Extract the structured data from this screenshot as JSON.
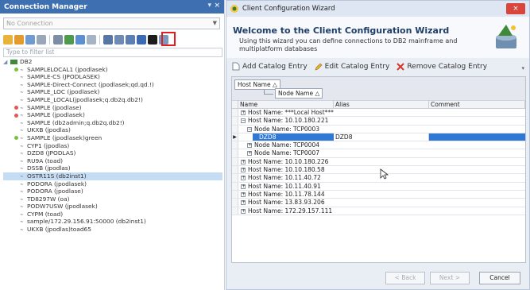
{
  "connection_manager": {
    "title": "Connection Manager",
    "title_controls": [
      "▾",
      "×"
    ],
    "connection_placeholder": "No Connection",
    "filter_placeholder": "Type to filter list",
    "tree": [
      {
        "label": "DB2",
        "status": "none",
        "level": 0
      },
      {
        "label": "SAMPLELOCAL1 (jpodlasek)",
        "status": "green",
        "level": 1
      },
      {
        "label": "SAMPLE-CS (JPODLASEK)",
        "status": "none",
        "level": 1
      },
      {
        "label": "SAMPLE-Direct-Connect (jpodlasek;qd.qd.!)",
        "status": "none",
        "level": 1
      },
      {
        "label": "SAMPLE_LOC (jpodlasek)",
        "status": "none",
        "level": 1
      },
      {
        "label": "SAMPLE_LOCAL(jpodlasek;q.db2q.db2!)",
        "status": "none",
        "level": 1
      },
      {
        "label": "SAMPLE (jpodlase)",
        "status": "red",
        "level": 1
      },
      {
        "label": "SAMPLE (jpodlasek)",
        "status": "red",
        "level": 1
      },
      {
        "label": "SAMPLE (db2admin;q.db2q.db2!)",
        "status": "none",
        "level": 1
      },
      {
        "label": "UKXB (jpodlas)",
        "status": "none",
        "level": 1
      },
      {
        "label": "SAMPLE (jpodlasek)green",
        "status": "green",
        "level": 1
      },
      {
        "label": "CYP1 (jpodlas)",
        "status": "none",
        "level": 1
      },
      {
        "label": "DZD8 (JPODLAS)",
        "status": "none",
        "level": 1
      },
      {
        "label": "RU9A (toad)",
        "status": "none",
        "level": 1
      },
      {
        "label": "DSSB (jpodlas)",
        "status": "none",
        "level": 1
      },
      {
        "label": "OSTR11S (db2inst1)",
        "status": "none",
        "level": 1,
        "selected": true
      },
      {
        "label": "PODORA (jpodlasek)",
        "status": "none",
        "level": 1
      },
      {
        "label": "PODORA (jpodlase)",
        "status": "none",
        "level": 1
      },
      {
        "label": "TD8297W (oa)",
        "status": "none",
        "level": 1
      },
      {
        "label": "PODW7USW (jpodlasek)",
        "status": "none",
        "level": 1
      },
      {
        "label": "CYPM (toad)",
        "status": "none",
        "level": 1
      },
      {
        "label": "sample/172.29.156.91:50000 (db2inst1)",
        "status": "none",
        "level": 1
      },
      {
        "label": "UKXB (jpodlas)toad65",
        "status": "none",
        "level": 1
      }
    ]
  },
  "wizard": {
    "window_title": "Client Configuration Wizard",
    "close_label": "×",
    "heading": "Welcome to the Client Configuration Wizard",
    "description": "Using this wizard you can define connections to DB2 mainframe and multiplatform databases",
    "actions": {
      "add": "Add Catalog Entry",
      "edit": "Edit Catalog Entry",
      "remove": "Remove Catalog Entry"
    },
    "group_by": {
      "host": "Host Name",
      "node": "Node Name",
      "sort_glyph": "△"
    },
    "columns": [
      "Name",
      "Alias",
      "Comment"
    ],
    "rows": [
      {
        "text": "Host Name: ***Local Host***",
        "indent": 0,
        "toggle": "+"
      },
      {
        "text": "Host Name: 10.10.180.221",
        "indent": 0,
        "toggle": "−"
      },
      {
        "text": "Node Name: TCP0003",
        "indent": 1,
        "toggle": "−"
      },
      {
        "text": "DZD8",
        "alias": "DZD8",
        "indent": 2,
        "toggle": "",
        "selected": true,
        "indicator": "▶"
      },
      {
        "text": "Node Name: TCP0004",
        "indent": 1,
        "toggle": "+"
      },
      {
        "text": "Node Name: TCP0007",
        "indent": 1,
        "toggle": "+"
      },
      {
        "text": "Host Name: 10.10.180.226",
        "indent": 0,
        "toggle": "+"
      },
      {
        "text": "Host Name: 10.10.180.58",
        "indent": 0,
        "toggle": "+"
      },
      {
        "text": "Host Name: 10.11.40.72",
        "indent": 0,
        "toggle": "+"
      },
      {
        "text": "Host Name: 10.11.40.91",
        "indent": 0,
        "toggle": "+"
      },
      {
        "text": "Host Name: 10.11.78.144",
        "indent": 0,
        "toggle": "+"
      },
      {
        "text": "Host Name: 13.83.93.206",
        "indent": 0,
        "toggle": "+"
      },
      {
        "text": "Host Name: 172.29.157.111",
        "indent": 0,
        "toggle": "+"
      }
    ],
    "more_glyph": "▾",
    "footer": {
      "back": "< Back",
      "next": "Next >",
      "cancel": "Cancel"
    }
  },
  "colors": {
    "cm_title_bg": "#3e6fb0",
    "selection": "#2f78d4",
    "close_button": "#d9443b"
  }
}
